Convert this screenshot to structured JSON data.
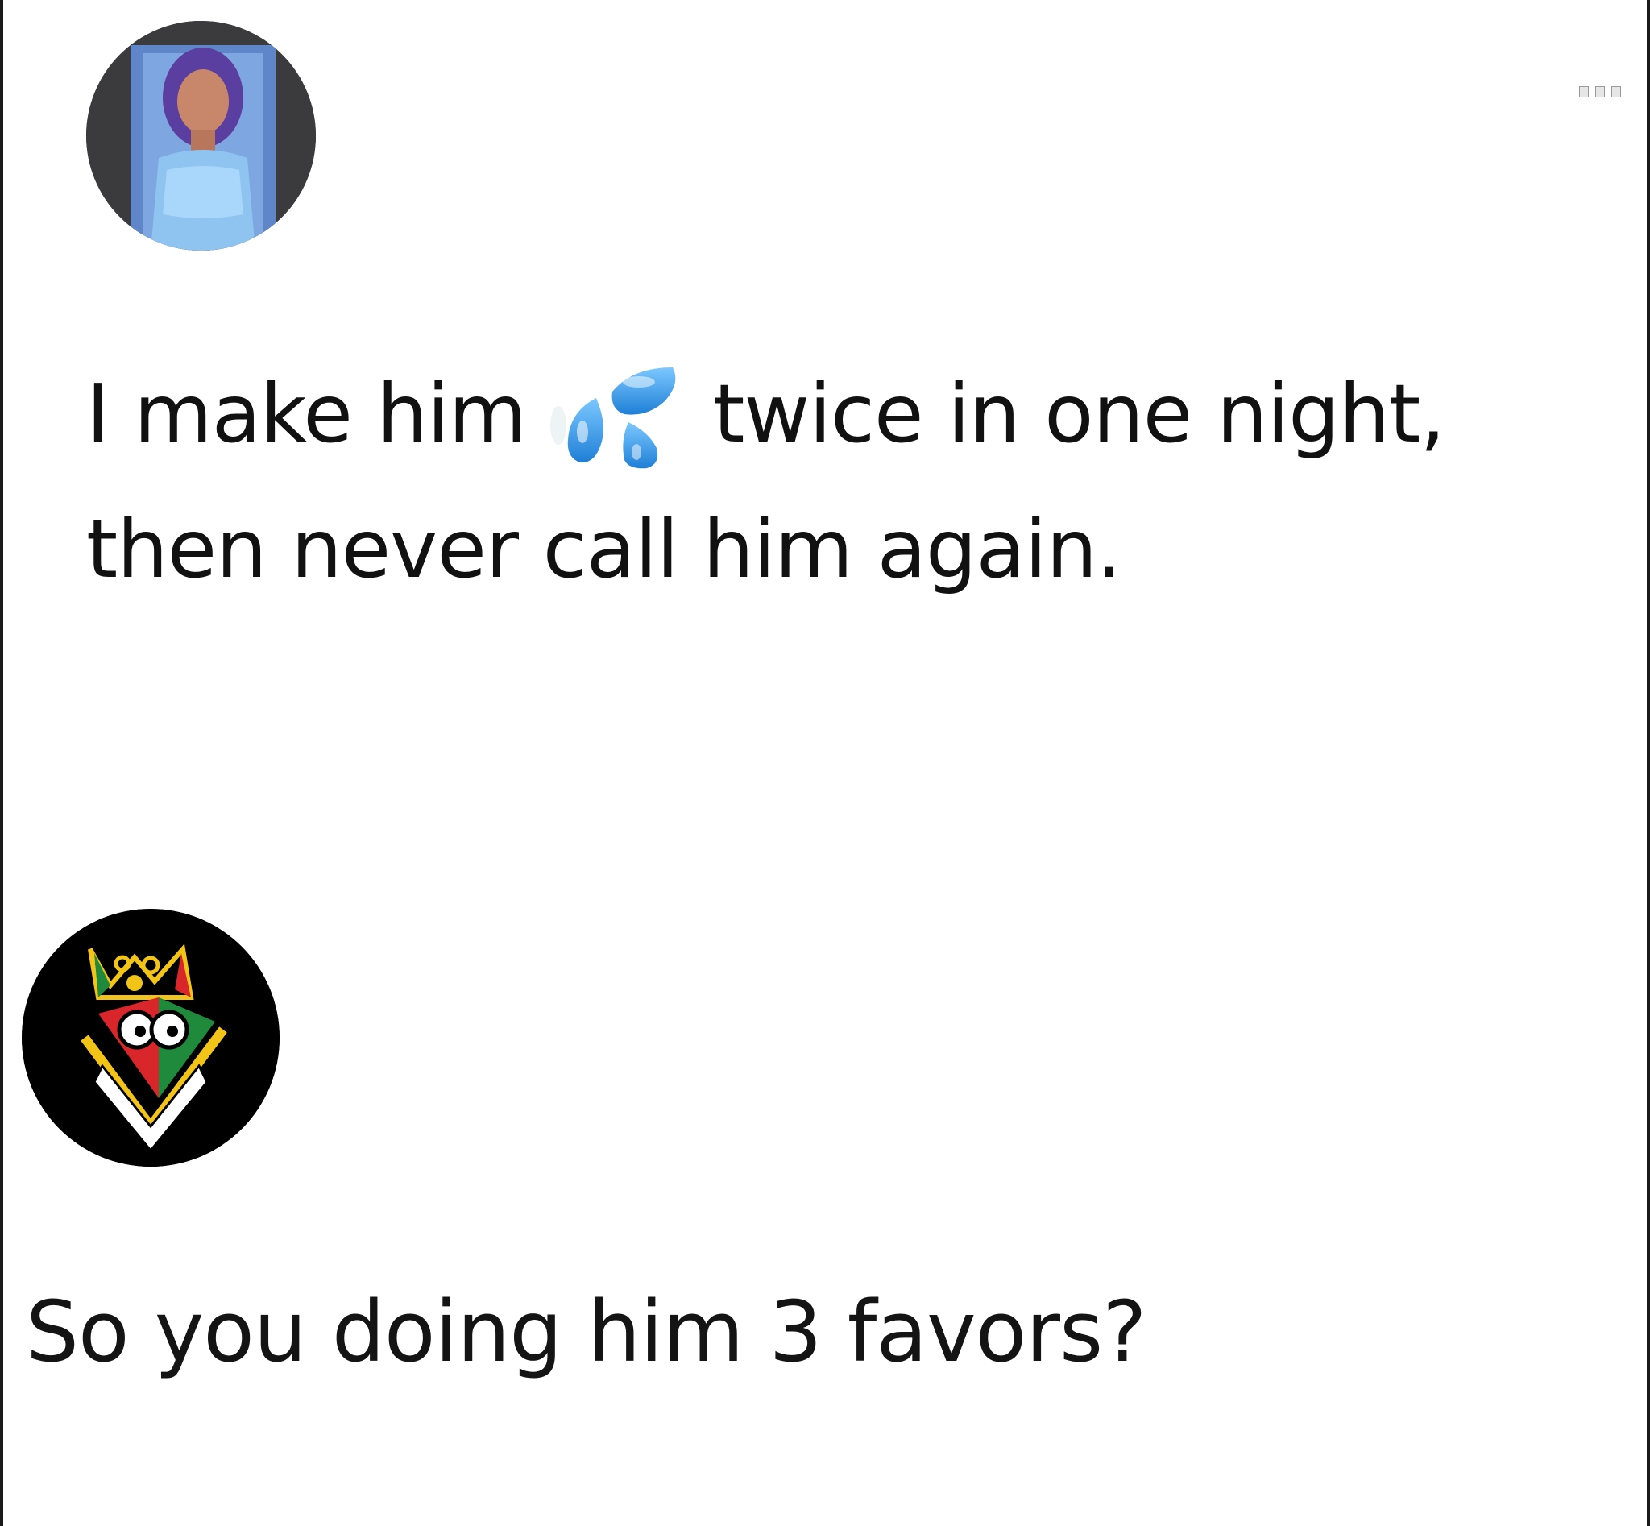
{
  "posts": [
    {
      "author_avatar": "profile-photo-woman-blue-hair",
      "text_line_1_before": "I make him",
      "emoji": "sweat-droplets-emoji",
      "text_line_1_after": "twice in one night,",
      "text_line_2": "then never call him again."
    },
    {
      "author_avatar": "crowned-cartoon-face-logo",
      "text": "So you doing him 3 favors?"
    }
  ],
  "colors": {
    "background": "#ffffff",
    "text": "#111111",
    "drop_blue": "#3aa0e8",
    "avatar2_bg": "#000000",
    "avatar2_red": "#d8262b",
    "avatar2_green": "#1f8a3c",
    "avatar2_yellow": "#f2c418"
  }
}
